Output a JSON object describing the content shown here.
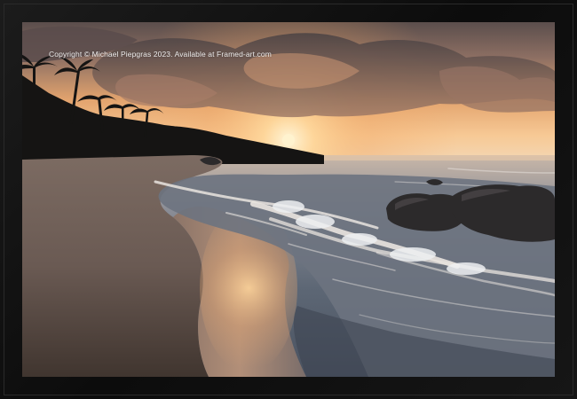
{
  "image": {
    "watermark": "Copyright © Michael Piepgras 2023. Available at Framed-art.com",
    "frame_label": "Framed Print",
    "scene": "tropical beach at sunset with palm trees, waves and rocks"
  },
  "colors": {
    "frame": "#111111",
    "sky_glow": "#f4b772",
    "sun": "#fff3cf",
    "sea": "#6f7d8c",
    "sand": "#8a7467"
  }
}
